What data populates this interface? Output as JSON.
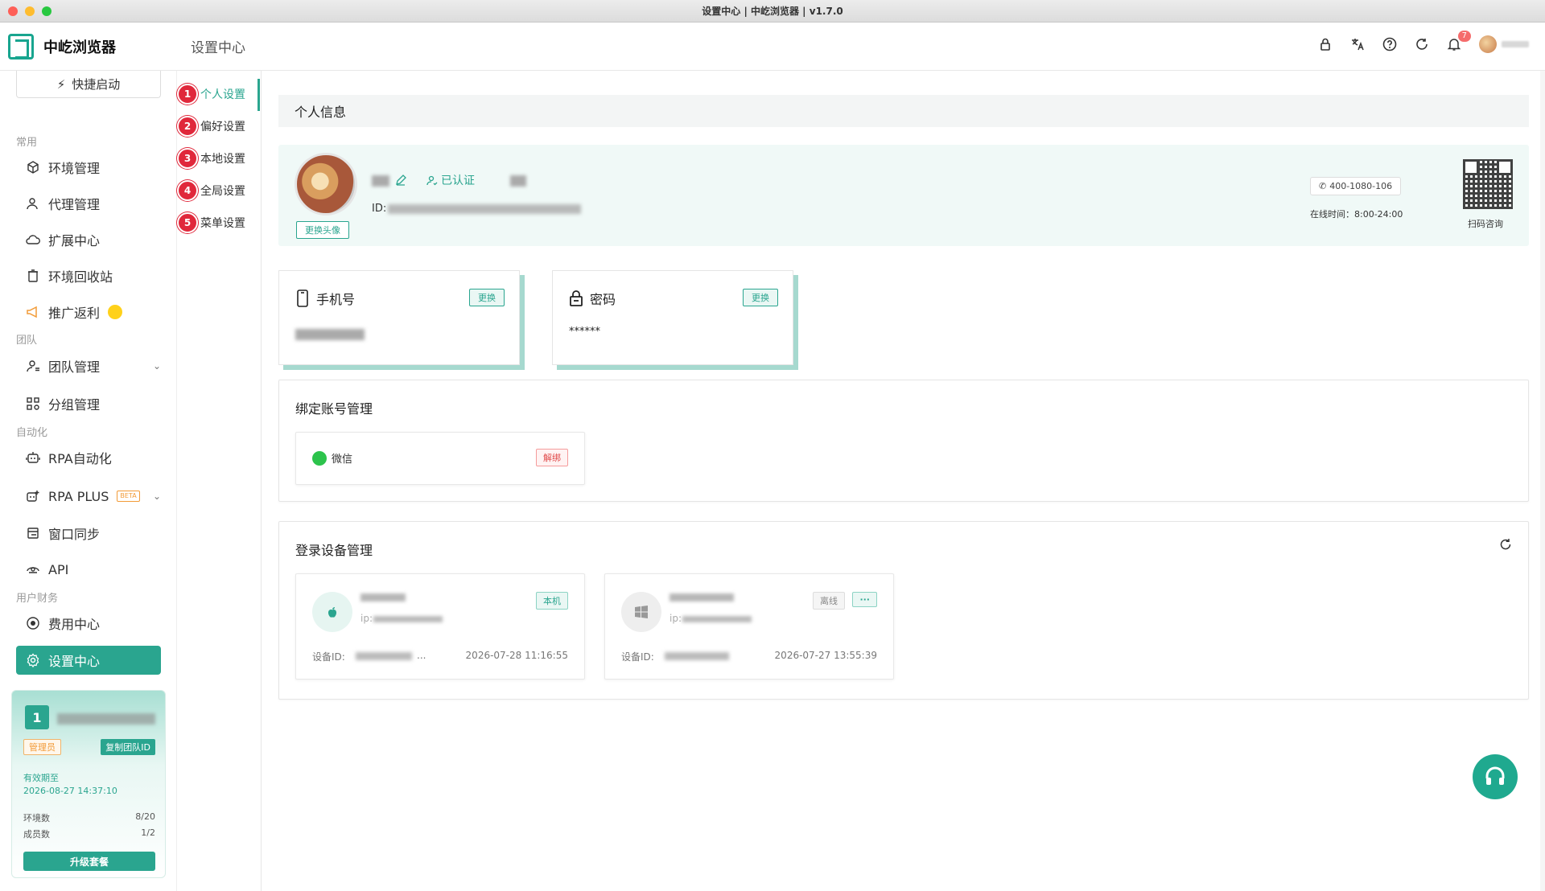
{
  "window": {
    "title": "设置中心 | 中屹浏览器 | v1.7.0"
  },
  "header": {
    "app_name": "中屹浏览器",
    "page_title": "设置中心",
    "notification_count": "7",
    "icons": [
      "lock-icon",
      "translate-icon",
      "help-icon",
      "refresh-icon",
      "bell-icon",
      "avatar"
    ]
  },
  "sidebar": {
    "quick_start": "快捷启动",
    "sections": {
      "common": "常用",
      "team": "团队",
      "automation": "自动化",
      "finance": "用户财务"
    },
    "items": {
      "env": "环境管理",
      "proxy": "代理管理",
      "ext": "扩展中心",
      "recycle": "环境回收站",
      "promo": "推广返利",
      "team": "团队管理",
      "group": "分组管理",
      "rpa": "RPA自动化",
      "rpa_plus": "RPA PLUS",
      "rpa_plus_badge": "BETA",
      "sync": "窗口同步",
      "api": "API",
      "billing": "费用中心",
      "settings": "设置中心"
    }
  },
  "team_card": {
    "number": "1",
    "role": "管理员",
    "copy_id": "复制团队ID",
    "expire_label": "有效期至",
    "expire_date": "2026-08-27 14:37:10",
    "env_label": "环境数",
    "env_value": "8/20",
    "member_label": "成员数",
    "member_value": "1/2",
    "upgrade": "升级套餐"
  },
  "subnav": [
    {
      "num": "1",
      "label": "个人设置"
    },
    {
      "num": "2",
      "label": "偏好设置"
    },
    {
      "num": "3",
      "label": "本地设置"
    },
    {
      "num": "4",
      "label": "全局设置"
    },
    {
      "num": "5",
      "label": "菜单设置"
    }
  ],
  "profile": {
    "section_title": "个人信息",
    "change_avatar": "更换头像",
    "verified": "已认证",
    "id_label": "ID:",
    "phone_number": "400-1080-106",
    "online_time": "在线时间：8:00-24:00",
    "qr_label": "扫码咨询"
  },
  "phone_card": {
    "title": "手机号",
    "change": "更换"
  },
  "password_card": {
    "title": "密码",
    "change": "更换",
    "value": "******"
  },
  "bind": {
    "title": "绑定账号管理",
    "wechat": "微信",
    "unbind": "解绑"
  },
  "devices": {
    "title": "登录设备管理",
    "list": [
      {
        "ip_label": "ip:",
        "tag": "本机",
        "id_label": "设备ID:",
        "id_suffix": "...",
        "time": "2026-07-28 11:16:55",
        "os": "apple"
      },
      {
        "ip_label": "ip:",
        "tag": "离线",
        "more": "···",
        "id_label": "设备ID:",
        "time": "2026-07-27 13:55:39",
        "os": "windows"
      }
    ]
  },
  "colors": {
    "accent": "#2aa58f",
    "badge": "#e0283b",
    "warning": "#f29b38"
  }
}
